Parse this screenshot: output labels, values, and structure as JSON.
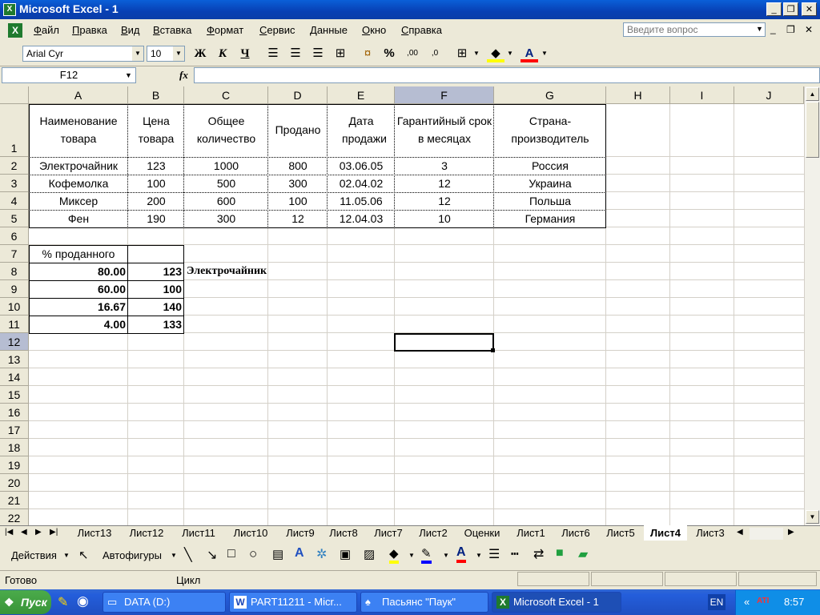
{
  "window": {
    "title": "Microsoft Excel - 1",
    "app_icon": "excel-icon"
  },
  "menu": {
    "items": [
      "Файл",
      "Правка",
      "Вид",
      "Вставка",
      "Формат",
      "Сервис",
      "Данные",
      "Окно",
      "Справка"
    ],
    "help_placeholder": "Введите вопрос"
  },
  "toolbar": {
    "font_name": "Arial Cyr",
    "font_size": "10",
    "bold": "Ж",
    "italic": "К",
    "underline": "Ч",
    "percent": "%"
  },
  "formula": {
    "name_box": "F12",
    "fx": "fx",
    "value": ""
  },
  "sheet": {
    "columns": [
      "A",
      "B",
      "C",
      "D",
      "E",
      "F",
      "G",
      "H",
      "I",
      "J"
    ],
    "selected_column": "F",
    "selected_row": "12",
    "rows": [
      "1",
      "2",
      "3",
      "4",
      "5",
      "6",
      "7",
      "8",
      "9",
      "10",
      "11",
      "12",
      "13",
      "14",
      "15",
      "16",
      "17",
      "18",
      "19",
      "20",
      "21",
      "22"
    ],
    "table_headers": [
      "Наименование товара",
      "Цена товара",
      "Общее количество",
      "Продано",
      "Дата продажи",
      "Гарантийный срок в месяцах",
      "Страна-производитель"
    ],
    "table_rows": [
      [
        "Электрочайник",
        "123",
        "1000",
        "800",
        "03.06.05",
        "3",
        "Россия"
      ],
      [
        "Кофемолка",
        "100",
        "500",
        "300",
        "02.04.02",
        "12",
        "Украина"
      ],
      [
        "Миксер",
        "200",
        "600",
        "100",
        "11.05.06",
        "12",
        "Польша"
      ],
      [
        "Фен",
        "190",
        "300",
        "12",
        "12.04.03",
        "10",
        "Германия"
      ]
    ],
    "percent_label": "% проданного",
    "percent_rows": [
      [
        "80.00",
        "123"
      ],
      [
        "60.00",
        "100"
      ],
      [
        "16.67",
        "140"
      ],
      [
        "4.00",
        "133"
      ]
    ],
    "c8_text": "Электрочайник"
  },
  "tabs": {
    "items": [
      "Лист13",
      "Лист12",
      "Лист11",
      "Лист10",
      "Лист9",
      "Лист8",
      "Лист7",
      "Лист2",
      "Оценки",
      "Лист1",
      "Лист6",
      "Лист5",
      "Лист4",
      "Лист3"
    ],
    "active": "Лист4"
  },
  "drawing": {
    "actions": "Действия",
    "autoshapes": "Автофигуры"
  },
  "status": {
    "ready": "Готово",
    "mode": "Цикл"
  },
  "taskbar": {
    "start": "Пуск",
    "items": [
      "DATA (D:)",
      "PART11211 - Micr...",
      "Пасьянс \"Паук\"",
      "Microsoft Excel - 1"
    ],
    "lang": "EN",
    "clock": "8:57"
  }
}
